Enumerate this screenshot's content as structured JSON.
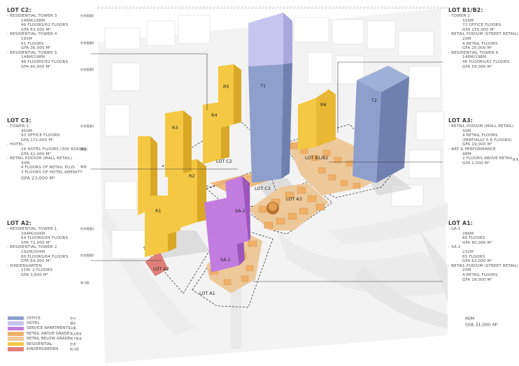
{
  "colors": {
    "office": "#8e9fcc",
    "hotel": "#c6c5ef",
    "service_apartments": "#c27ce0",
    "retail_above_grade": "#f0b066",
    "retail_below_grade": "#edc99a",
    "residential": "#f4c842",
    "kindergarden": "#e0807a"
  },
  "lot_c2": {
    "title": "LOT C2:",
    "items": [
      {
        "header": "- RESIDENTIAL TOWER 3",
        "cn": "住宅塔楼3",
        "details": [
          "148M/198M",
          "46 FLOORS/62 FLOORS",
          "GFA 63,000 M²"
        ]
      },
      {
        "header": "- RESIDENTIAL TOWER 4",
        "cn": "住宅塔楼4",
        "details": [
          "195M",
          "61 FLOORS",
          "GFA 36,000 M²"
        ]
      },
      {
        "header": "- RESIDENTIAL TOWER 5",
        "cn": "住宅塔楼5",
        "details": [
          "148M/198M",
          "46 FLOORS/62 FLOORS",
          "GFA 60,000 M²"
        ]
      }
    ]
  },
  "lot_c3": {
    "title": "LOT C3:",
    "items": [
      {
        "header": "- TOWER 1",
        "cn": "住宅塔楼1",
        "details": [
          "450M",
          "93 OFFICE FLOORS",
          "GFA 172,000 M²"
        ]
      },
      {
        "header": "- HOTEL",
        "cn": "酒店",
        "details": [
          "16 HOTEL FLOORS (300 ROOMS)",
          "GFA 42,000 M²"
        ]
      },
      {
        "header": "- RETAIL PODIUM (MALL RETAIL)",
        "cn": "商场",
        "details": [
          "30M",
          "4 FLOORS OF RETAIL PLUS",
          "3 FLOORS OF HOTEL AMENITY"
        ],
        "total": "GFA 23,000 M²"
      }
    ]
  },
  "lot_a2": {
    "title": "LOT A2:",
    "items": [
      {
        "header": "- RESIDENTIAL TOWER 1",
        "cn": "住宅塔楼1",
        "details": [
          "204M/204M",
          "64 FLOORS/64 FLOORS",
          "GFA 72,000 M²"
        ]
      },
      {
        "header": "- RESIDENTIAL TOWER 2",
        "cn": "住宅塔楼2",
        "details": [
          "192M/204M",
          "60 FLOORS/64 FLOORS",
          "GFA 64,000 M²"
        ]
      },
      {
        "header": "- KINDERGARTEN",
        "cn": "幼儿园",
        "details": [
          "11M, 2 FLOORS",
          "GFA 3,600 M²"
        ]
      }
    ]
  },
  "lot_b1b2": {
    "title": "LOT B1/B2:",
    "items": [
      {
        "header": "- TOWER 2",
        "details": [
          "316M",
          "72 OFFICE FLOORS",
          "GFA 155,000 M²"
        ]
      },
      {
        "header": "- RETAIL PODIUM (STREET RETAIL)",
        "details": [
          "20M",
          "4 RETAIL FLOORS",
          "GFA 26,000 M²"
        ]
      },
      {
        "header": "- RESIDENTIAL TOWER 6",
        "details": [
          "148M/198M",
          "46 FLOORS/62 FLOORS",
          "GFA 59,000 M²"
        ]
      }
    ]
  },
  "lot_a3": {
    "title": "LOT A3:",
    "items": [
      {
        "header": "- RETAIL PODIUM (MALL RETAIL)",
        "details": [
          "30M",
          "4 RETAIL FLOORS",
          "(PARTIALLY 5-6 FLOORS)",
          "GFA 19,000 M²"
        ]
      },
      {
        "header": "- ART & PERFORMANCE",
        "cn": "艺术",
        "details": [
          "48M",
          "2 FLOORS ABOVE RETAIL",
          "GFA 2,000 M²"
        ]
      }
    ]
  },
  "lot_a1": {
    "title": "LOT A1:",
    "items": [
      {
        "header": "- SA-1",
        "details": [
          "284M",
          "80 FLOORS",
          "GFA 80,000 M²"
        ]
      },
      {
        "header": "- SA-2",
        "details": [
          "232M",
          "65 FLOORS",
          "GFA 63,000 M²"
        ]
      },
      {
        "header": "- RETAIL PODIUM (STREET RETAIL)",
        "details": [
          "20M",
          "4 RETAIL FLOORS",
          "GFA 18,000 M²"
        ]
      }
    ],
    "mm": "M/M",
    "mm_gfa": "GFA 31,000 M²"
  },
  "legend": [
    {
      "label": "OFFICE",
      "cn": "办公",
      "color": "#8e9fcc"
    },
    {
      "label": "HOTEL",
      "cn": "酒店",
      "color": "#c6c5ef"
    },
    {
      "label": "SERVICE APARTMENTS",
      "cn": "公寓",
      "color": "#c27ce0"
    },
    {
      "label": "RETAIL ABOVE GRADE",
      "cn": "地上商业",
      "color": "#f0b066"
    },
    {
      "label": "RETAIL BELOW GRADE",
      "cn": "地下商业",
      "color": "#edc99a"
    },
    {
      "label": "RESIDENTIAL",
      "cn": "住宅",
      "color": "#f4c842"
    },
    {
      "label": "KINDERGARDEN",
      "cn": "幼儿园",
      "color": "#e0807a"
    }
  ],
  "map_labels": {
    "t1": "T1",
    "t2": "T2",
    "r1": "R1",
    "r2": "R2",
    "r3": "R3",
    "r4": "R4",
    "r5": "R5",
    "r6": "R6",
    "sa1": "SA-1",
    "sa2": "SA-2",
    "lot_c2": "LOT C2",
    "lot_c3": "LOT C3",
    "lot_b1b2": "LOT B1/B2",
    "lot_a3": "LOT A3",
    "lot_a2": "LOT A2",
    "lot_a1": "LOT A1"
  }
}
